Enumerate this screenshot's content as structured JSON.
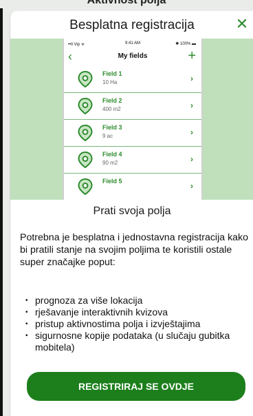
{
  "background": {
    "title": "Aktivnost polja"
  },
  "modal": {
    "title": "Besplatna registracija",
    "close_glyph": "✕"
  },
  "phone": {
    "status": {
      "signal": "••ll Vip ᯤ",
      "time": "9:41 AM",
      "battery": "✱ 100% ▬"
    },
    "nav": {
      "back_glyph": "‹",
      "title": "My fields",
      "add_glyph": "+"
    },
    "fields": [
      {
        "name": "Field 1",
        "area": "10 Ha"
      },
      {
        "name": "Field 2",
        "area": "400 m2"
      },
      {
        "name": "Field 3",
        "area": "9 ac"
      },
      {
        "name": "Field 4",
        "area": "90 m2"
      },
      {
        "name": "Field 5",
        "area": ""
      }
    ],
    "chevron_glyph": "›"
  },
  "content": {
    "section_title": "Prati svoja polja",
    "description": "Potrebna je besplatna i jednostavna registracija kako bi pratili stanje na svojim poljima te koristili ostale super značajke poput:",
    "bullet_glyph": "•",
    "features": [
      "prognoza za više lokacija",
      "rješavanje interaktivnih kvizova",
      "pristup aktivnostima polja i izvještajima",
      "sigurnosne kopije podataka (u slučaju gubitka mobitela)"
    ],
    "register_label": "REGISTRIRAJ SE OVDJE"
  },
  "colors": {
    "accent": "#2e8b2e",
    "button": "#1c7f1c",
    "hero_bg": "#bfe0bb"
  }
}
